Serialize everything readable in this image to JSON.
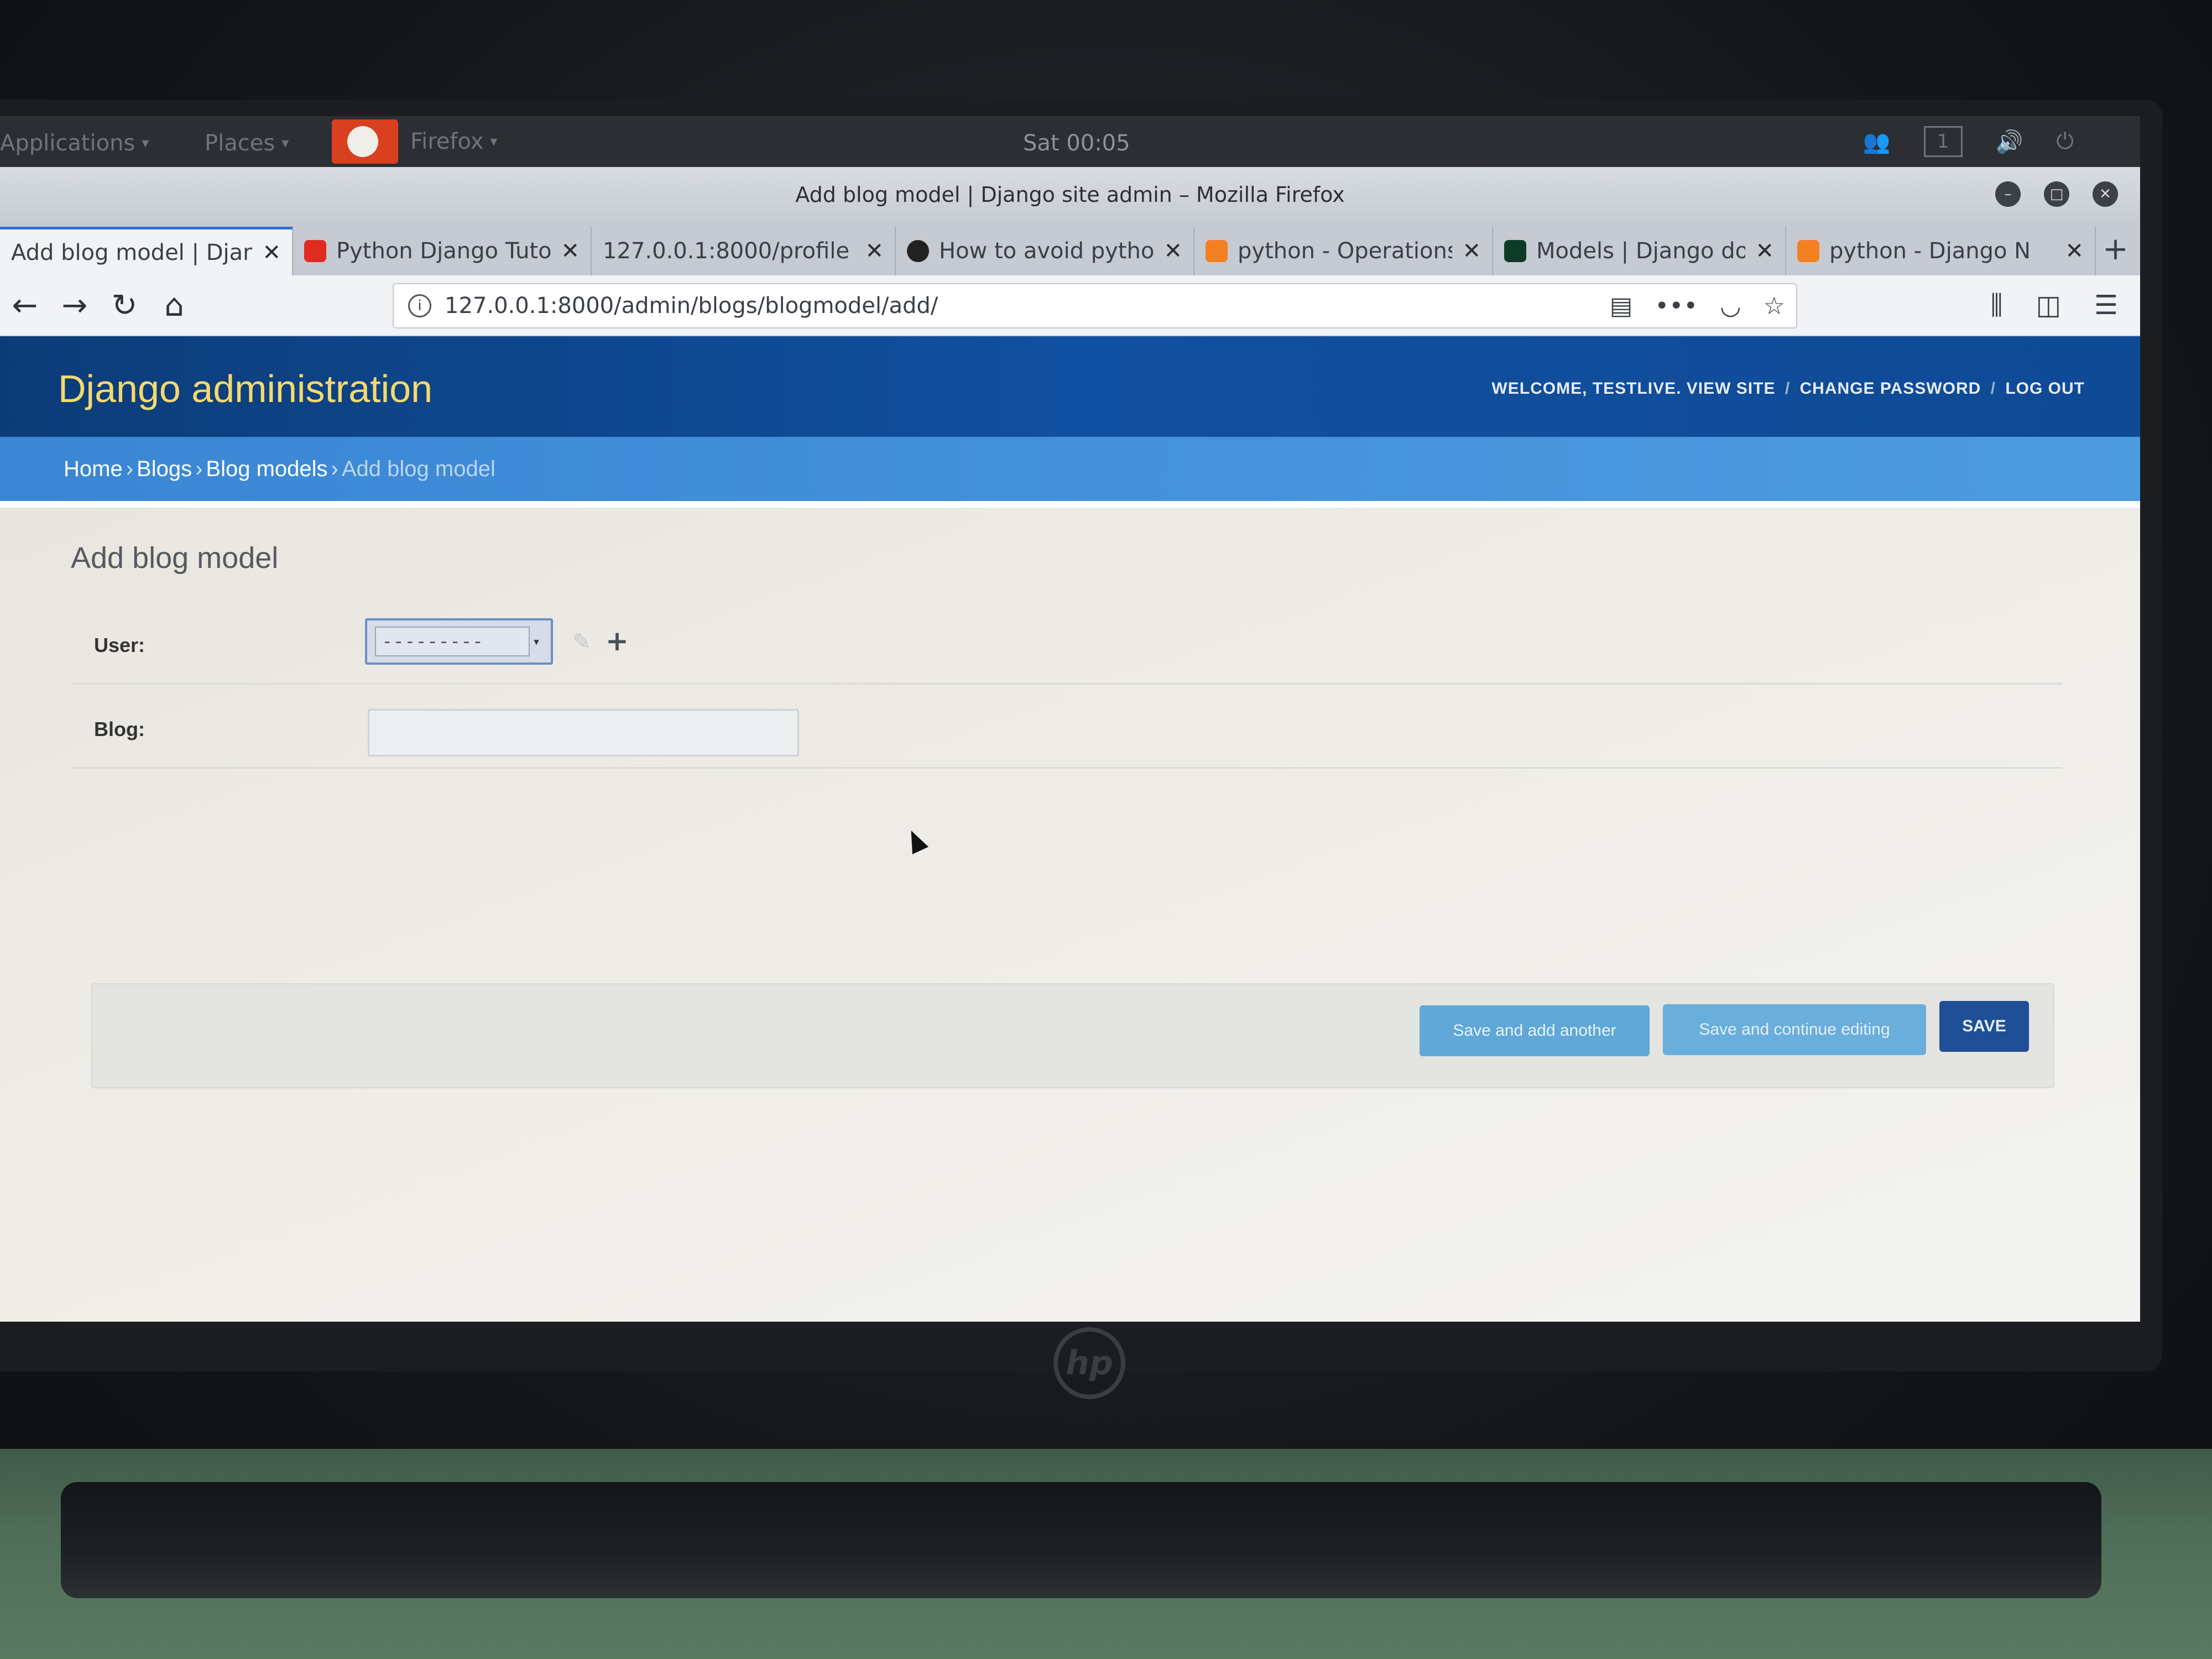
{
  "os_topbar": {
    "applications": "Applications",
    "places": "Places",
    "firefox": "Firefox",
    "clock": "Sat 00:05",
    "workspace": "1"
  },
  "window": {
    "title": "Add blog model | Django site admin – Mozilla Firefox"
  },
  "tabs": [
    {
      "title": "Add blog model | Djang",
      "favicon": "django-icon",
      "color": "#f2f3f5",
      "active": true
    },
    {
      "title": "Python Django Tuto",
      "favicon": "youtube-icon",
      "color": "#e02b20"
    },
    {
      "title": "127.0.0.1:8000/profile",
      "favicon": "none"
    },
    {
      "title": "How to avoid pytho",
      "favicon": "github-icon",
      "color": "#222222"
    },
    {
      "title": "python - Operations",
      "favicon": "stackoverflow-icon",
      "color": "#f48024"
    },
    {
      "title": "Models | Django do",
      "favicon": "django-docs-icon",
      "color": "#0c3c26"
    },
    {
      "title": "python - Django N",
      "favicon": "stackoverflow-icon",
      "color": "#f48024"
    }
  ],
  "navbar": {
    "url": "127.0.0.1:8000/admin/blogs/blogmodel/add/"
  },
  "admin": {
    "site_name": "Django administration",
    "user_tools": {
      "welcome": "WELCOME,",
      "username": "TESTLIVE",
      "view_site": "VIEW SITE",
      "change_password": "CHANGE PASSWORD",
      "log_out": "LOG OUT"
    },
    "breadcrumbs": {
      "home": "Home",
      "app": "Blogs",
      "model": "Blog models",
      "current": "Add blog model"
    },
    "page_title": "Add blog model",
    "form": {
      "user_label": "User:",
      "user_selected": "---------",
      "blog_label": "Blog:",
      "blog_value": ""
    },
    "buttons": {
      "save_add_another": "Save and add another",
      "save_continue": "Save and continue editing",
      "save": "SAVE"
    },
    "colors": {
      "header": "#0c3c78",
      "site_name": "#f5d96b",
      "breadcrumbs": "#3a86d4",
      "save_button": "#1f4f96",
      "secondary_button": "#5fa8d8"
    }
  }
}
